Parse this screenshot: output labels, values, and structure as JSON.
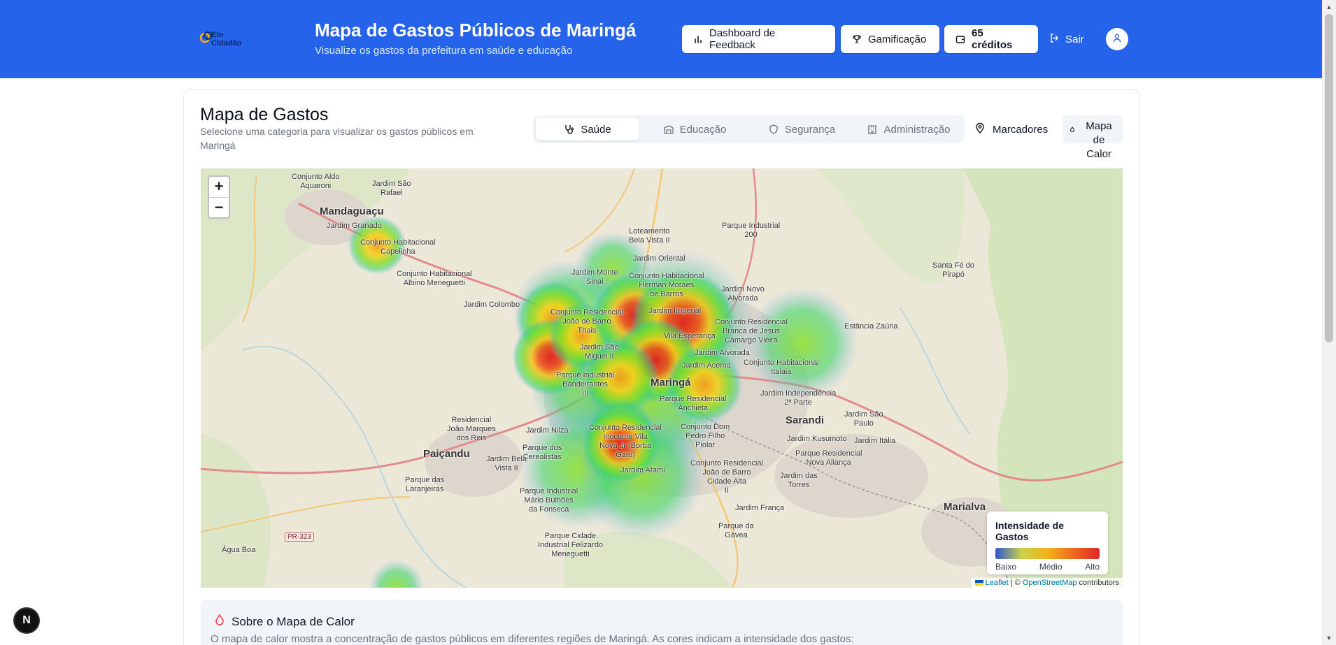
{
  "header": {
    "logo_text_1": "Elo",
    "logo_text_2": "Cidadão",
    "title": "Mapa de Gastos Públicos de Maringá",
    "subtitle": "Visualize os gastos da prefeitura em saúde e educação",
    "buttons": {
      "dashboard": "Dashboard de Feedback",
      "gamificacao": "Gamificação",
      "creditos": "65 créditos",
      "sair": "Sair"
    }
  },
  "card": {
    "title": "Mapa de Gastos",
    "description": "Selecione uma categoria para visualizar os gastos públicos em Maringá",
    "tabs": [
      {
        "label": "Saúde",
        "icon": "stethoscope-icon",
        "active": true
      },
      {
        "label": "Educação",
        "icon": "school-icon",
        "active": false
      },
      {
        "label": "Segurança",
        "icon": "shield-icon",
        "active": false
      },
      {
        "label": "Administração",
        "icon": "building-icon",
        "active": false
      }
    ],
    "toggles": {
      "marcadores": "Marcadores",
      "mapa_de_calor": "Mapa de Calor"
    }
  },
  "map": {
    "zoom_in": "+",
    "zoom_out": "−",
    "places": {
      "mandaguacu": "Mandaguaçu",
      "conjunto_aldo": "Conjunto Aldo\nAquaroni",
      "jardim_sao_rafael": "Jardim São\nRafael",
      "jardim_granado": "Jardim Granado",
      "capelinha": "Conjunto Habitacional\nCapelinha",
      "albino": "Conjunto Habitacional\nAlbino Meneguetti",
      "jardim_colombo": "Jardim Colombo",
      "lot_bela_vista": "Loteamento\nBela Vista II",
      "jardim_oriental": "Jardim Oriental",
      "parque_industrial_200": "Parque Industrial\n200",
      "monte_sinai": "Jardim Monte\nSinai",
      "herman": "Conjunto Habitacional\nHerman Moraes\nde Barros",
      "novo_alvorada": "Jardim Novo\nAlvorada",
      "joao_de_barro": "Conjunto Residencial\nJoão de Barro\nThais",
      "jardim_imperial": "Jardim Imperial",
      "branca_vieira": "Conjunto Residencial\nBranca de Jesus\nCamargo Vieira",
      "estancia_zauna": "Estância Zaúna",
      "santa_fe": "Santa Fé do\nPirapó",
      "sao_miguel": "Jardim São\nMiguel II",
      "vila_esperanca": "Vila Esperança",
      "jardim_alvorada": "Jardim Alvorada",
      "jardim_acema": "Jardim Acema",
      "itaiaia": "Conjunto Habitacional\nItaiaia",
      "bandeirantes": "Parque Industrial\nBandeirantes\nIII",
      "maringa": "Maringá",
      "anchieta": "Parque Residencial\nAnchieta",
      "independencia": "Jardim Independência\n2ª Parte",
      "sarandi": "Sarandi",
      "jardim_sao_paulo": "Jardim São\nPaulo",
      "residencial_joao_marques": "Residencial\nJoão Marques\ndos Reis",
      "jardim_nilza": "Jardim Nilza",
      "cerealistas": "Parque dos\nCerealistas",
      "inocente_vila": "Conjunto Residencial\nInocente Vila\nNova Jr (Borba\nGato)",
      "dom_pedro": "Conjunto Dom\nPedro Filho\nPiolar",
      "jardim_kusumoto": "Jardim Kusumoto",
      "jardim_italia": "Jardim Itália",
      "nova_alianca": "Parque Residencial\nNova Aliança",
      "paicandu": "Paiçandu",
      "jardim_bela_vista": "Jardim Bela\nVista II",
      "jardim_atami": "Jardim Atami",
      "cidade_alta": "Conjunto Residencial\nJoão de Barro\nCidade Alta\nII",
      "jardim_das_torres": "Jardim das\nTorres",
      "laranjeiras": "Parque das\nLaranjeiras",
      "mario_bulhoes": "Parque Industrial\nMário Bulhões\nda Fonseca",
      "jardim_franca": "Jardim França",
      "gavea": "Parque da\nGávea",
      "felizardo": "Parque Cidade\nIndustrial Felizardo\nMeneguetti",
      "marialva": "Marialva",
      "agua_boa": "Água Boa"
    },
    "road_pr323": "PR-323",
    "legend": {
      "title": "Intensidade de Gastos",
      "low": "Baixo",
      "mid": "Médio",
      "high": "Alto"
    },
    "attribution": {
      "leaflet": "Leaflet",
      "separator": " | © ",
      "osm": "OpenStreetMap",
      "contributors": " contributors"
    },
    "colors": {
      "low": "#2f55d4",
      "mid": "#f4b21a",
      "high": "#dc2626"
    }
  },
  "info": {
    "title": "Sobre o Mapa de Calor",
    "text": "O mapa de calor mostra a concentração de gastos públicos em diferentes regiões de Maringá. As cores indicam a intensidade dos gastos:"
  },
  "next_badge": "N"
}
